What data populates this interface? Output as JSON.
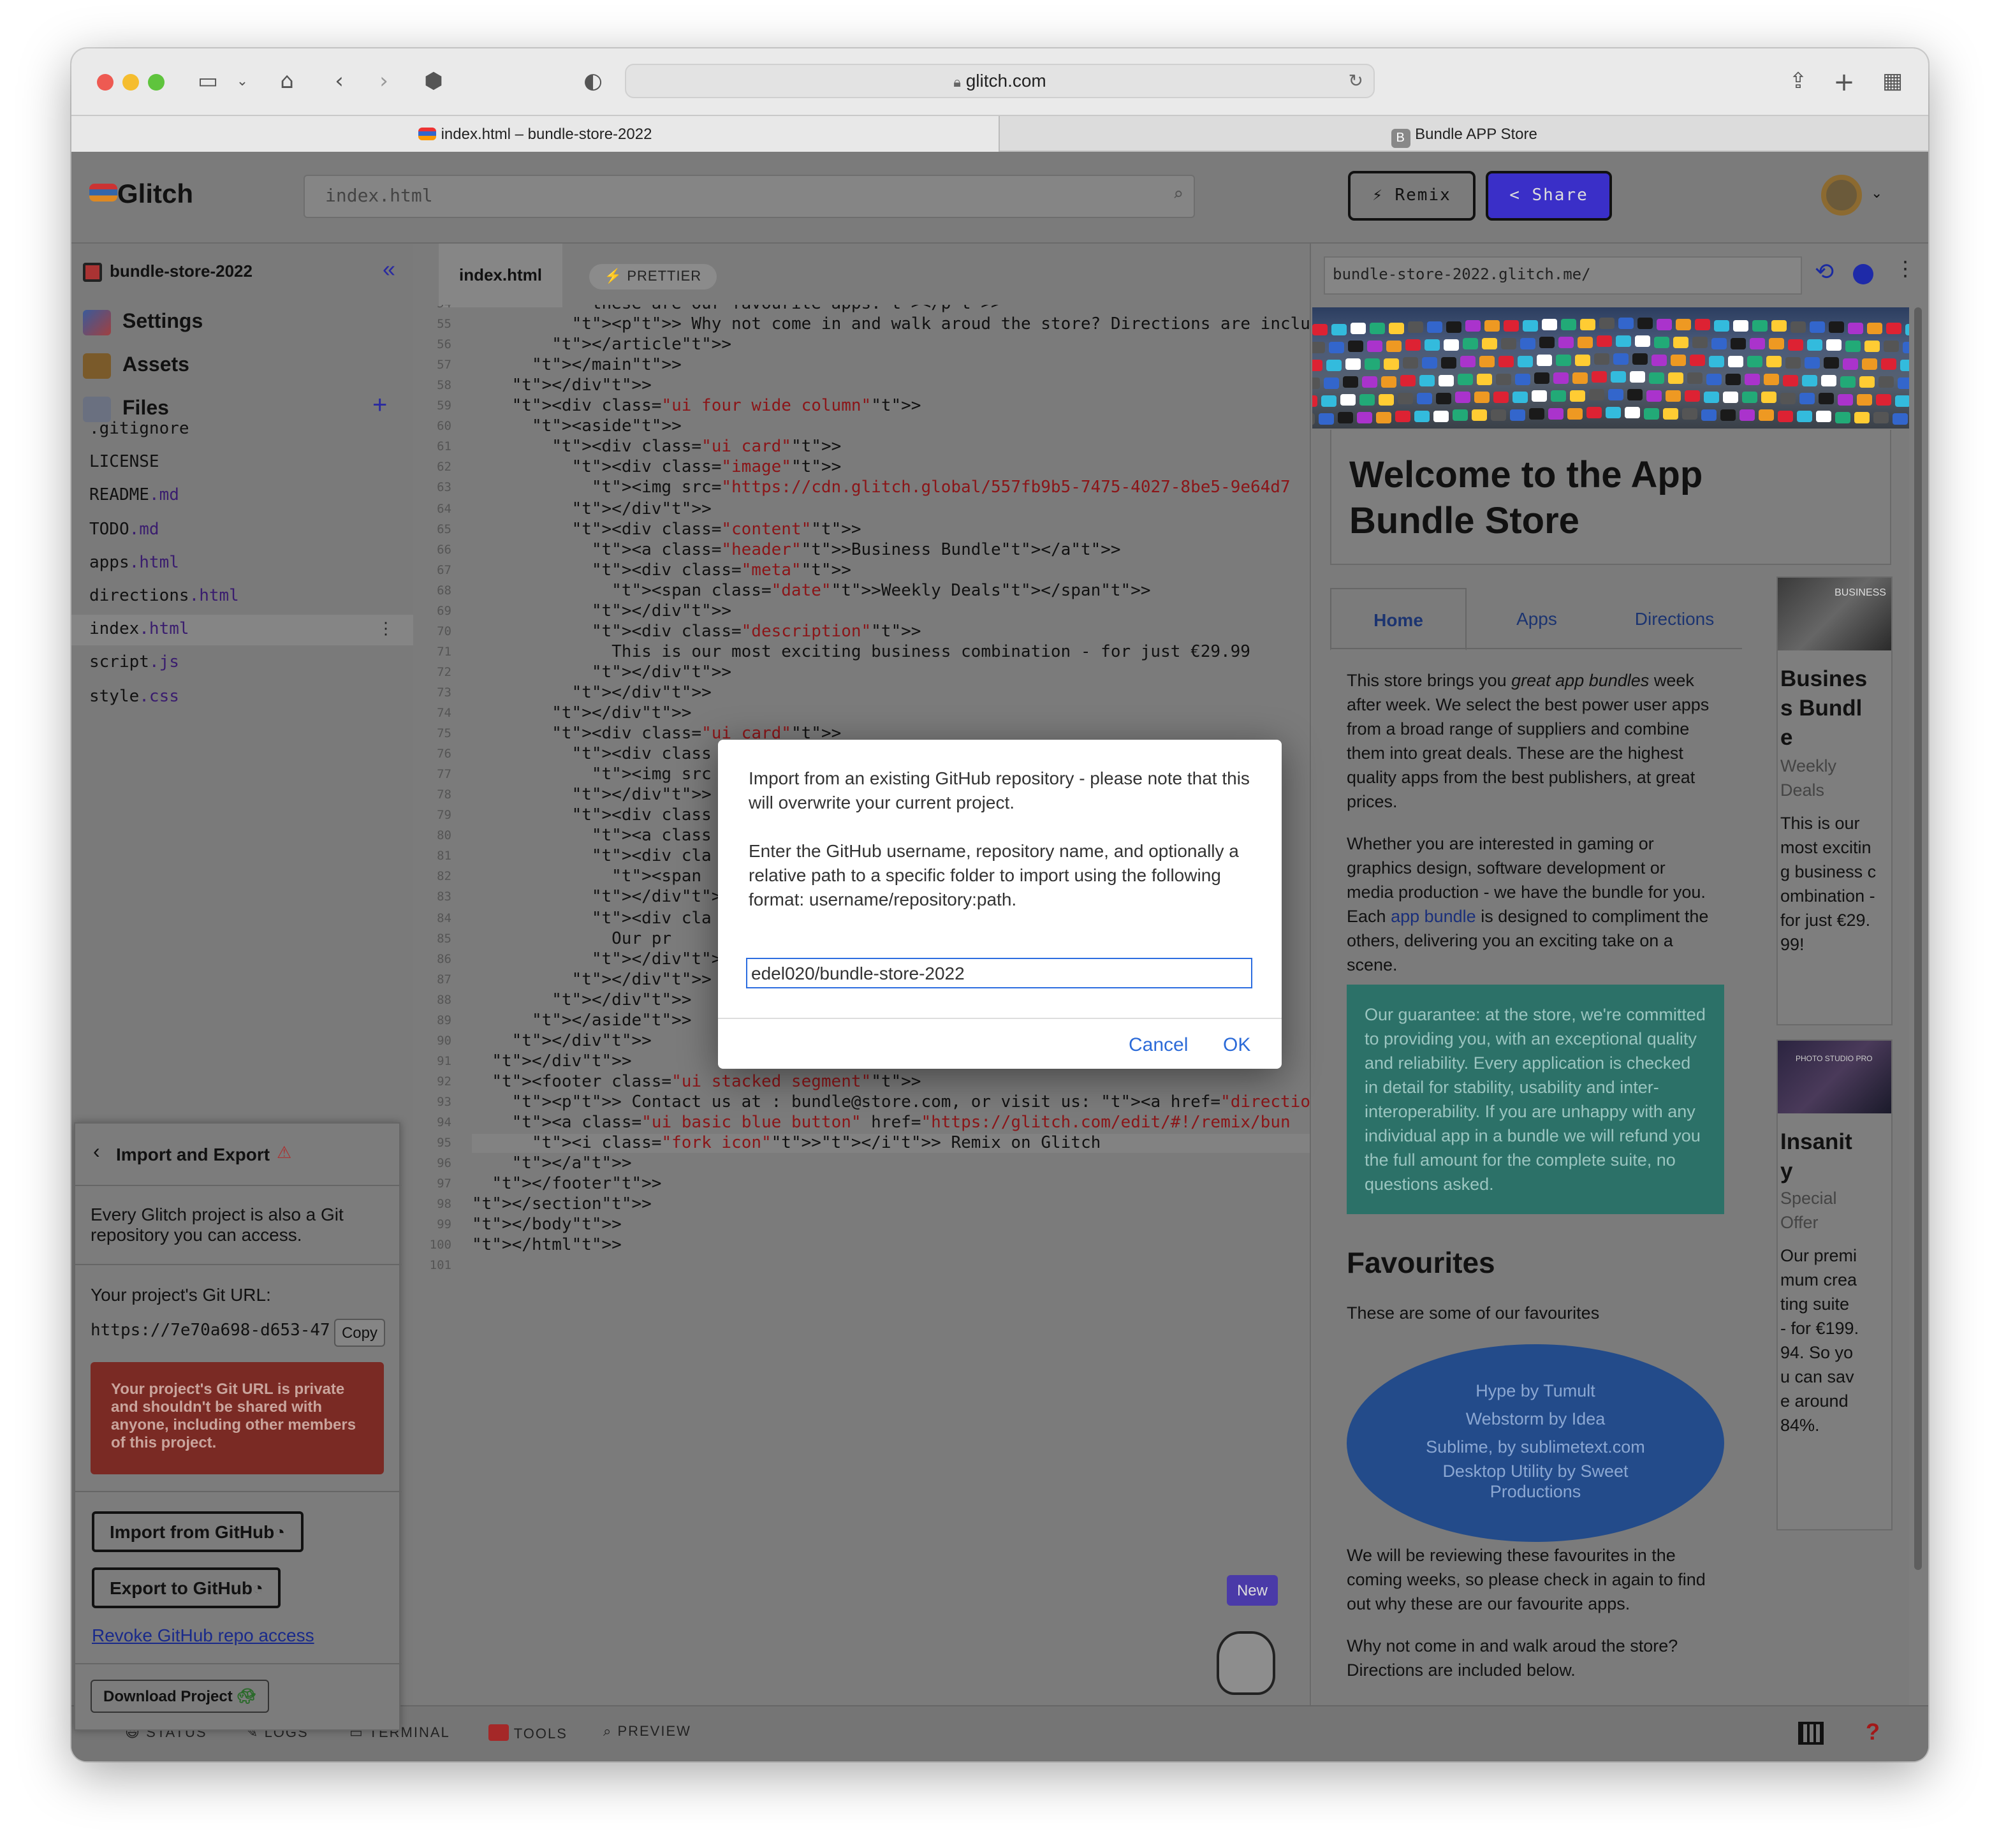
{
  "browser": {
    "address": "glitch.com",
    "tabs": [
      {
        "label": "index.html – bundle-store-2022"
      },
      {
        "label": "Bundle APP Store",
        "badge": "B"
      }
    ]
  },
  "glitch": {
    "logo": "Glitch",
    "search_value": "index.html",
    "remix_label": "⚡ Remix",
    "share_label": "< Share",
    "project_name": "bundle-store-2022",
    "collapse_icon": "«",
    "nav": [
      "Settings",
      "Assets",
      "Files"
    ],
    "files": [
      {
        "base": ".gitignore",
        "ext": ""
      },
      {
        "base": "LICENSE",
        "ext": ""
      },
      {
        "base": "README",
        "ext": ".md"
      },
      {
        "base": "TODO",
        "ext": ".md"
      },
      {
        "base": "apps",
        "ext": ".html"
      },
      {
        "base": "directions",
        "ext": ".html"
      },
      {
        "base": "index",
        "ext": ".html"
      },
      {
        "base": "script",
        "ext": ".js"
      },
      {
        "base": "style",
        "ext": ".css"
      }
    ],
    "editor_tab": "index.html",
    "prettier": "⚡ PRETTIER",
    "preview_url": "bundle-store-2022.glitch.me/",
    "bottom_bar": [
      "STATUS",
      "LOGS",
      "TERMINAL",
      "TOOLS",
      "PREVIEW"
    ],
    "new_badge": "New"
  },
  "code_lines": [
    {
      "n": "54",
      "text": "            these are our favourite apps.</p>"
    },
    {
      "n": "55",
      "text": "          <p> Why not come in and walk aroud the store? Directions are include"
    },
    {
      "n": "56",
      "text": "        </article>"
    },
    {
      "n": "57",
      "text": "      </main>"
    },
    {
      "n": "58",
      "text": "    </div>"
    },
    {
      "n": "59",
      "text": "    <div class=\"ui four wide column\">"
    },
    {
      "n": "60",
      "text": "      <aside>"
    },
    {
      "n": "61",
      "text": "        <div class=\"ui card\">"
    },
    {
      "n": "62",
      "text": "          <div class=\"image\">"
    },
    {
      "n": "63",
      "text": "            <img src=\"https://cdn.glitch.global/557fb9b5-7475-4027-8be5-9e64d7"
    },
    {
      "n": "64",
      "text": "          </div>"
    },
    {
      "n": "65",
      "text": "          <div class=\"content\">"
    },
    {
      "n": "66",
      "text": "            <a class=\"header\">Business Bundle</a>"
    },
    {
      "n": "67",
      "text": "            <div class=\"meta\">"
    },
    {
      "n": "68",
      "text": "              <span class=\"date\">Weekly Deals</span>"
    },
    {
      "n": "69",
      "text": "            </div>"
    },
    {
      "n": "70",
      "text": "            <div class=\"description\">"
    },
    {
      "n": "71",
      "text": "              This is our most exciting business combination - for just €29.99"
    },
    {
      "n": "72",
      "text": "            </div>"
    },
    {
      "n": "73",
      "text": "          </div>"
    },
    {
      "n": "74",
      "text": "        </div>"
    },
    {
      "n": "75",
      "text": "        <div class=\"ui card\">"
    },
    {
      "n": "76",
      "text": "          <div class"
    },
    {
      "n": "77",
      "text": "            <img src                                                    4d7"
    },
    {
      "n": "78",
      "text": "          </div>"
    },
    {
      "n": "79",
      "text": "          <div class"
    },
    {
      "n": "80",
      "text": "            <a class"
    },
    {
      "n": "81",
      "text": "            <div cla"
    },
    {
      "n": "82",
      "text": "              <span"
    },
    {
      "n": "83",
      "text": "            </div>"
    },
    {
      "n": "84",
      "text": "            <div cla"
    },
    {
      "n": "85",
      "text": "              Our pr                                                    ard"
    },
    {
      "n": "86",
      "text": "            </div>"
    },
    {
      "n": "87",
      "text": "          </div>"
    },
    {
      "n": "88",
      "text": "        </div>"
    },
    {
      "n": "89",
      "text": "      </aside>"
    },
    {
      "n": "90",
      "text": "    </div>"
    },
    {
      "n": "91",
      "text": "  </div>"
    },
    {
      "n": "92",
      "text": "  <footer class=\"ui stacked segment\">"
    },
    {
      "n": "93",
      "text": "    <p> Contact us at : bundle@store.com, or visit us: <a href=\"directions.htm"
    },
    {
      "n": "94",
      "text": "    <a class=\"ui basic blue button\" href=\"https://glitch.com/edit/#!/remix/bun"
    },
    {
      "n": "95",
      "text": "      <i class=\"fork icon\"></i> Remix on Glitch"
    },
    {
      "n": "96",
      "text": "    </a>"
    },
    {
      "n": "97",
      "text": "  </footer>"
    },
    {
      "n": "98",
      "text": "</section>"
    },
    {
      "n": "99",
      "text": "</body>"
    },
    {
      "n": "100",
      "text": "</html>"
    },
    {
      "n": "101",
      "text": ""
    }
  ],
  "import_export": {
    "title": "Import and Export",
    "intro": "Every Glitch project is also a Git repository you can access.",
    "git_url_label": "Your project's Git URL:",
    "git_url": "https://7e70a698-d653-47",
    "copy_label": "Copy",
    "warning": "Your project's Git URL is private and shouldn't be shared with anyone, including other members of this project.",
    "import_button": "Import from GitHub",
    "export_button": "Export to GitHub",
    "revoke_link": "Revoke GitHub repo access",
    "download_button": "Download Project"
  },
  "preview": {
    "heading": "Welcome to the App Bundle Store",
    "tabs": [
      "Home",
      "Apps",
      "Directions"
    ],
    "para1_before": "This store brings you ",
    "para1_em": "great app bundles",
    "para1_after": " week after week. We select the best power user apps from a broad range of suppliers and combine them into great deals. These are the highest quality apps from the best publishers, at great prices.",
    "para2_before": "Whether you are interested in gaming or graphics design, software development or media production - we have the bundle for you. Each ",
    "para2_link": "app bundle",
    "para2_after": " is designed to compliment the others, delivering you an exciting take on a scene.",
    "guarantee": "Our guarantee: at the store, we're committed to providing you, with an exceptional quality and reliability. Every application is checked in detail for stability, usability and inter-interoperability. If you are unhappy with any individual app in a bundle we will refund you the full amount for the complete suite, no questions asked.",
    "favourites_title": "Favourites",
    "favourites_intro": "These are some of our favourites",
    "favourites": [
      "Hype by Tumult",
      "Webstorm by Idea",
      "Sublime, by sublimetext.com",
      "Desktop Utility by Sweet Productions"
    ],
    "review_text": "We will be reviewing these favourites in the coming weeks, so please check in again to find out why these are our favourite apps.",
    "walk_text": "Why not come in and walk aroud the store? Directions are included below.",
    "card1": {
      "title": "Business Bundle",
      "meta": "Weekly Deals",
      "desc": "This is our most exciting business combination - for just €29.99!",
      "img_text": "BUSINESS"
    },
    "card2": {
      "title": "Insanity",
      "meta": "Special Offer",
      "desc": "Our premimum creating suite - for €199.94. So you can save around 84%.",
      "img_text": "PHOTO STUDIO PRO"
    }
  },
  "dialog": {
    "message1": "Import from an existing GitHub repository - please note that this will overwrite your current project.",
    "message2": "Enter the GitHub username, repository name, and optionally a relative path to a specific folder to import using the following format: username/repository:path.",
    "input_value": "edel020/bundle-store-2022",
    "cancel": "Cancel",
    "ok": "OK"
  }
}
